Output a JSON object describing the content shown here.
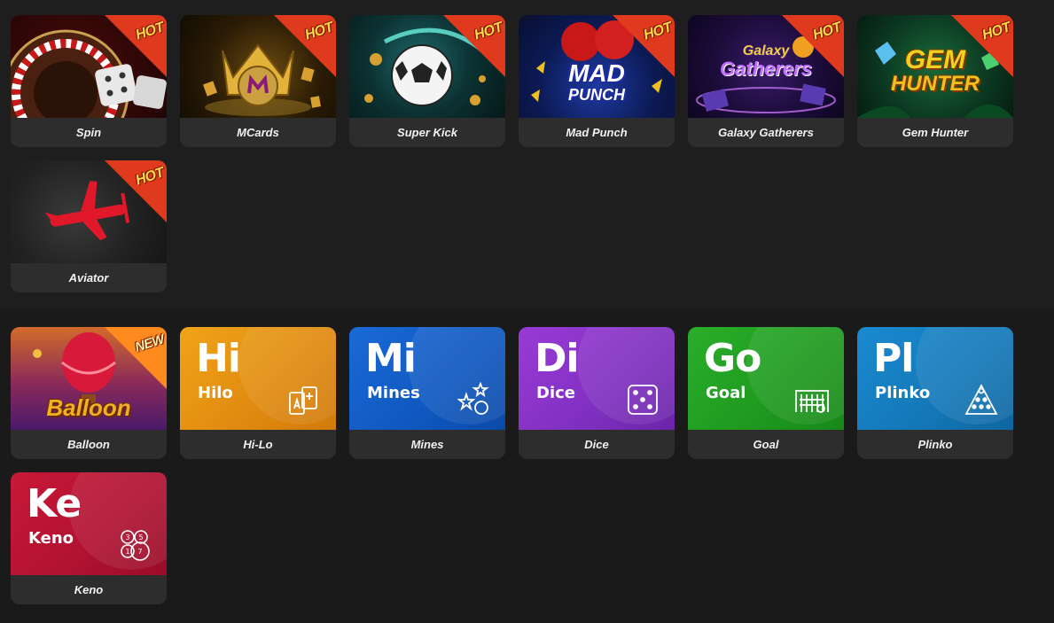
{
  "colors": {
    "hot_badge": "#e03a1e",
    "new_badge": "#ff8a1e",
    "card_caption_bg": "#2d2d2d",
    "page_bg": "#1c1c1c"
  },
  "featured": {
    "games": [
      {
        "name": "Spin",
        "badge": "HOT",
        "icon": "roulette-dice-art"
      },
      {
        "name": "MCards",
        "badge": "HOT",
        "icon": "golden-crown-art"
      },
      {
        "name": "Super Kick",
        "badge": "HOT",
        "icon": "soccer-ball-art"
      },
      {
        "name": "Mad Punch",
        "badge": "HOT",
        "icon": "boxing-gloves-art",
        "art_text_line1": "MAD",
        "art_text_line2": "PUNCH"
      },
      {
        "name": "Galaxy Gatherers",
        "badge": "HOT",
        "icon": "galaxy-cards-art",
        "art_text_line1": "Galaxy",
        "art_text_line2": "Gatherers"
      },
      {
        "name": "Gem Hunter",
        "badge": "HOT",
        "icon": "gem-art",
        "art_text_line1": "GEM",
        "art_text_line2": "HUNTER"
      },
      {
        "name": "Aviator",
        "badge": "HOT",
        "icon": "red-plane-art"
      }
    ]
  },
  "mini": {
    "games": [
      {
        "name": "Balloon",
        "badge": "NEW",
        "icon": "hot-air-balloon-art",
        "art_text": "Balloon"
      },
      {
        "name": "Hi-Lo",
        "abbr": "Hi",
        "label": "Hilo",
        "icon": "cards-icon",
        "color": "#f0a418"
      },
      {
        "name": "Mines",
        "abbr": "Mi",
        "label": "Mines",
        "icon": "stars-bomb-icon",
        "color": "#1a6ad6"
      },
      {
        "name": "Dice",
        "abbr": "Di",
        "label": "Dice",
        "icon": "dice-icon",
        "color": "#9a3ad6"
      },
      {
        "name": "Goal",
        "abbr": "Go",
        "label": "Goal",
        "icon": "goal-net-icon",
        "color": "#2aae2a"
      },
      {
        "name": "Plinko",
        "abbr": "Pl",
        "label": "Plinko",
        "icon": "plinko-pyramid-icon",
        "color": "#1a8ad0"
      },
      {
        "name": "Keno",
        "abbr": "Ke",
        "label": "Keno",
        "icon": "keno-balls-icon",
        "color": "#c81838",
        "balls": [
          "3",
          "5",
          "1",
          "7"
        ]
      }
    ]
  }
}
